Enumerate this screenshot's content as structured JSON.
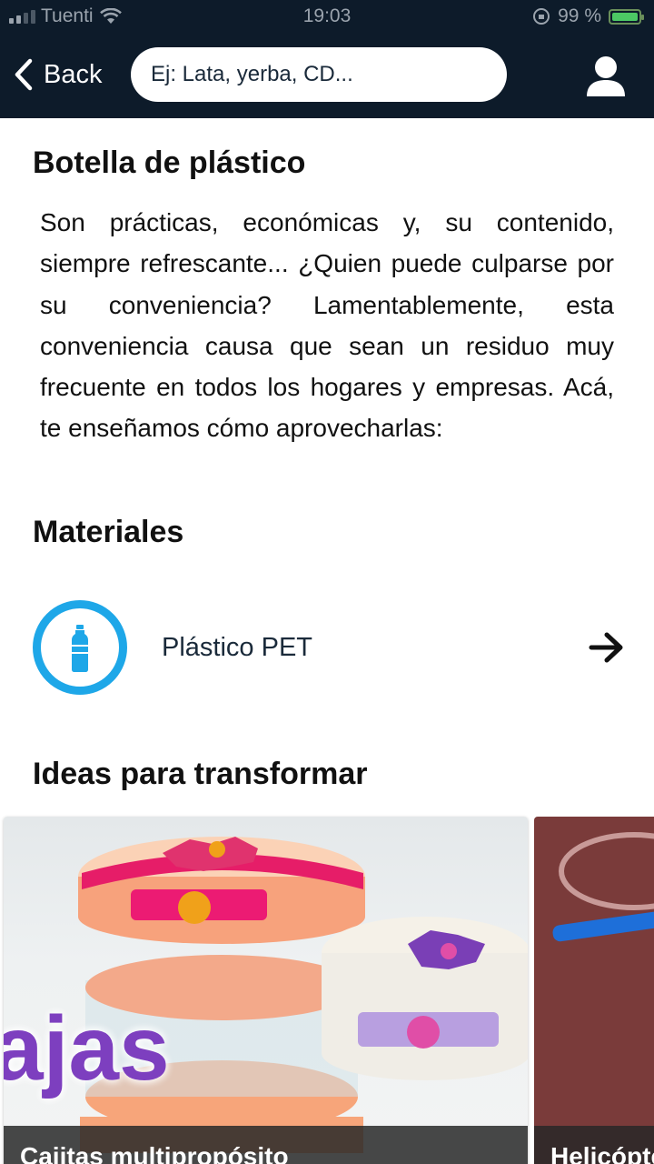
{
  "status_bar": {
    "carrier": "Tuenti",
    "time": "19:03",
    "battery": "99 %"
  },
  "nav": {
    "back_label": "Back",
    "search_placeholder": "Ej: Lata, yerba, CD..."
  },
  "page": {
    "title": "Botella de plástico",
    "description": "Son prácticas, económicas y, su contenido, siempre refrescante... ¿Quien puede culparse por su conveniencia? Lamentablemente, esta conveniencia causa que sean un residuo muy frecuente en todos los hogares y empresas. Acá, te enseñamos cómo aprovecharlas:"
  },
  "materials": {
    "title": "Materiales",
    "items": [
      {
        "label": "Plástico PET",
        "icon": "plastic-bottle-icon",
        "accent": "#1ea7e8"
      }
    ]
  },
  "ideas": {
    "title": "Ideas para transformar",
    "cards": [
      {
        "title": "Cajitas multipropósito",
        "overlay_text": "ajas"
      },
      {
        "title": "Helicóptero"
      }
    ]
  },
  "colors": {
    "nav_background": "#0d1b2a",
    "accent": "#1ea7e8"
  }
}
